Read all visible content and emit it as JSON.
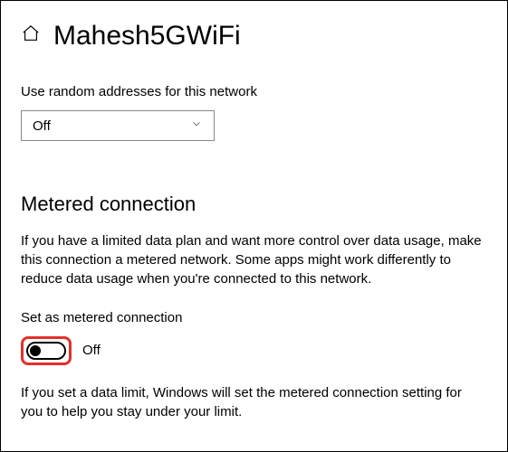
{
  "header": {
    "title": "Mahesh5GWiFi"
  },
  "randomAddresses": {
    "label": "Use random addresses for this network",
    "selected": "Off"
  },
  "metered": {
    "heading": "Metered connection",
    "description": "If you have a limited data plan and want more control over data usage, make this connection a metered network. Some apps might work differently to reduce data usage when you're connected to this network.",
    "toggleLabel": "Set as metered connection",
    "toggleState": "Off",
    "dataLimitNote": "If you set a data limit, Windows will set the metered connection setting for you to help you stay under your limit."
  }
}
